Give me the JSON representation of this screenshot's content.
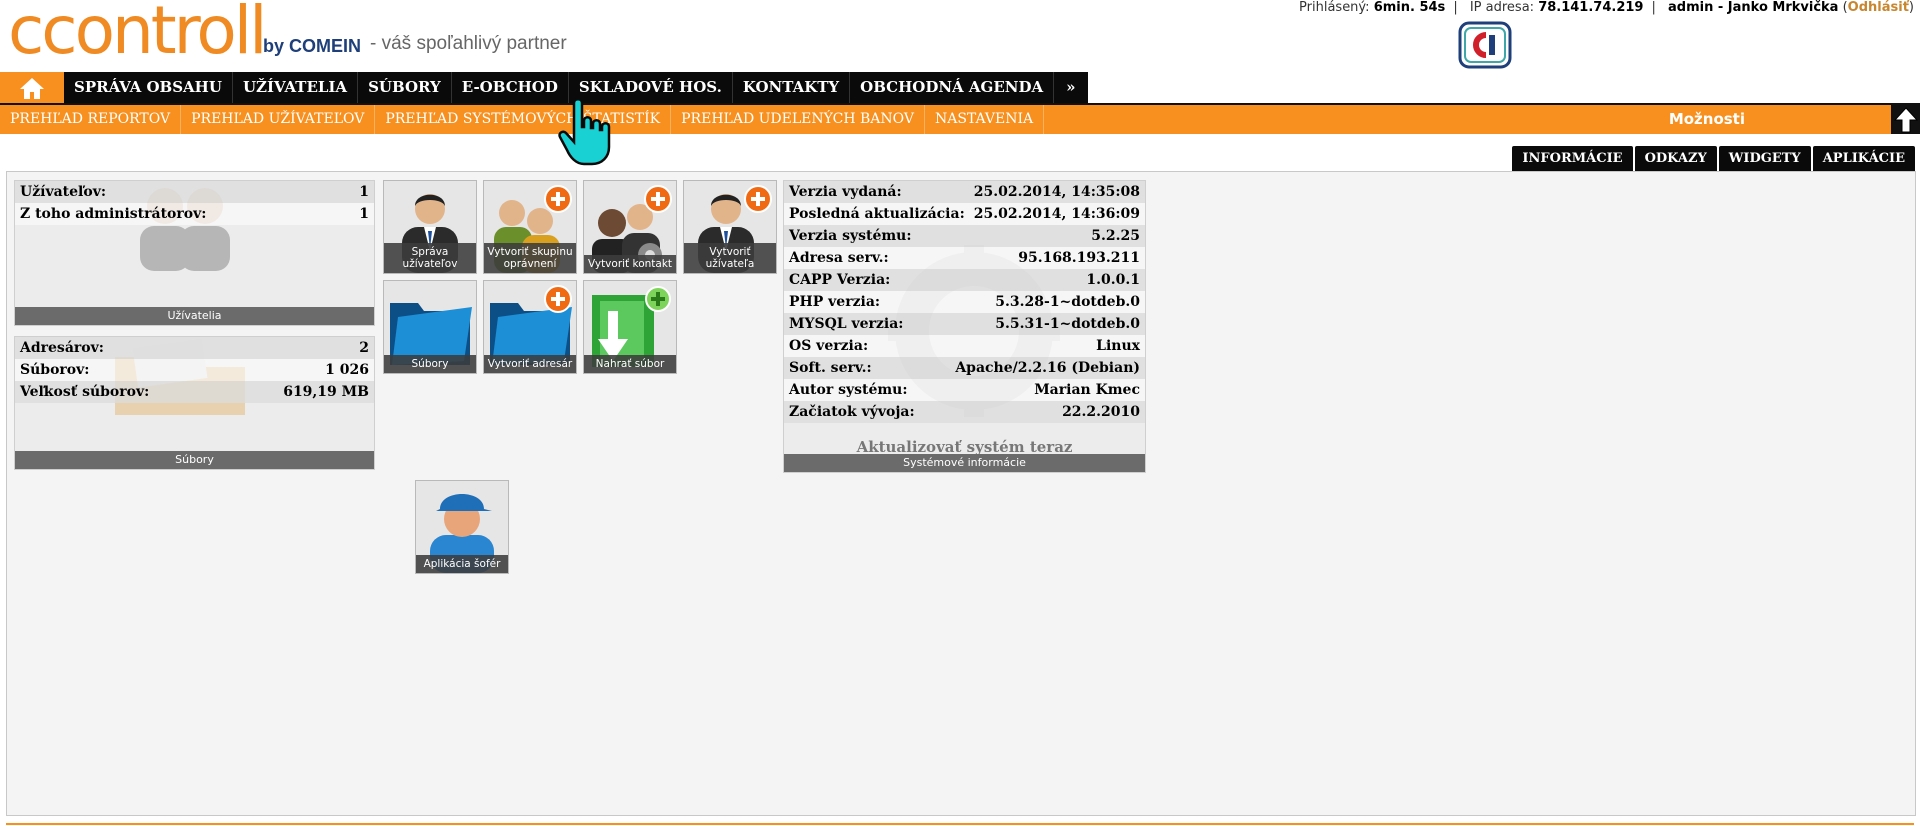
{
  "header": {
    "brand": "ccontroll",
    "brand_by": "by COMEIN",
    "tagline": "- váš spoľahlivý partner",
    "session": {
      "logged_label": "Prihlásený:",
      "logged_value": "6min. 54s",
      "ip_label": "IP adresa:",
      "ip_value": "78.141.74.219",
      "user": "admin - Janko Mrkvička",
      "logout": "Odhlásiť"
    }
  },
  "mainnav": {
    "items": [
      "SPRÁVA OBSAHU",
      "UŽÍVATELIA",
      "SÚBORY",
      "E-OBCHOD",
      "SKLADOVÉ HOS.",
      "KONTAKTY",
      "OBCHODNÁ AGENDA"
    ],
    "more": "»"
  },
  "subnav": {
    "items": [
      "PREHĽAD REPORTOV",
      "PREHĽAD UŽÍVATEĽOV",
      "PREHĽAD SYSTÉMOVÝCH ŠTATISTÍK",
      "PREHĽAD UDELENÝCH BANOV",
      "NASTAVENIA"
    ],
    "options": "Možnosti"
  },
  "tabs": [
    "INFORMÁCIE",
    "ODKAZY",
    "WIDGETY",
    "APLIKÁCIE"
  ],
  "users_panel": {
    "rows": [
      {
        "label": "Užívateľov:",
        "value": "1"
      },
      {
        "label": "Z toho administrátorov:",
        "value": "1"
      }
    ],
    "footer": "Užívatelia"
  },
  "files_panel": {
    "rows": [
      {
        "label": "Adresárov:",
        "value": "2"
      },
      {
        "label": "Súborov:",
        "value": "1 026"
      },
      {
        "label": "Veľkosť súborov:",
        "value": "619,19 MB"
      }
    ],
    "footer": "Súbory"
  },
  "tiles": [
    {
      "caption": "Správa užívateľov",
      "icon": "user-manager-icon"
    },
    {
      "caption": "Vytvoriť skupinu oprávnení",
      "icon": "create-group-icon"
    },
    {
      "caption": "Vytvoriť kontakt",
      "icon": "create-contact-icon"
    },
    {
      "caption": "Vytvoriť užívateľa",
      "icon": "create-user-icon"
    },
    {
      "caption": "Súbory",
      "icon": "folder-icon"
    },
    {
      "caption": "Vytvoriť adresár",
      "icon": "create-folder-icon"
    },
    {
      "caption": "Nahrať súbor",
      "icon": "upload-file-icon"
    },
    {
      "caption": "Aplikácia šofér",
      "icon": "driver-app-icon"
    }
  ],
  "sysinfo_panel": {
    "rows": [
      {
        "label": "Verzia vydaná:",
        "value": "25.02.2014, 14:35:08"
      },
      {
        "label": "Posledná aktualizácia:",
        "value": "25.02.2014, 14:36:09"
      },
      {
        "label": "Verzia systému:",
        "value": "5.2.25"
      },
      {
        "label": "Adresa serv.:",
        "value": "95.168.193.211"
      },
      {
        "label": "CAPP Verzia:",
        "value": "1.0.0.1"
      },
      {
        "label": "PHP verzia:",
        "value": "5.3.28-1~dotdeb.0"
      },
      {
        "label": "MYSQL verzia:",
        "value": "5.5.31-1~dotdeb.0"
      },
      {
        "label": "OS verzia:",
        "value": "Linux"
      },
      {
        "label": "Soft. serv.:",
        "value": "Apache/2.2.16 (Debian)"
      },
      {
        "label": "Autor systému:",
        "value": "Marian Kmec"
      },
      {
        "label": "Začiatok vývoja:",
        "value": "22.2.2010"
      }
    ],
    "update_link": "Aktualizovať systém teraz",
    "footer": "Systémové informácie"
  },
  "colors": {
    "accent": "#f7901e",
    "nav": "#0a0a0a",
    "brand_blue": "#1e3f7a"
  }
}
